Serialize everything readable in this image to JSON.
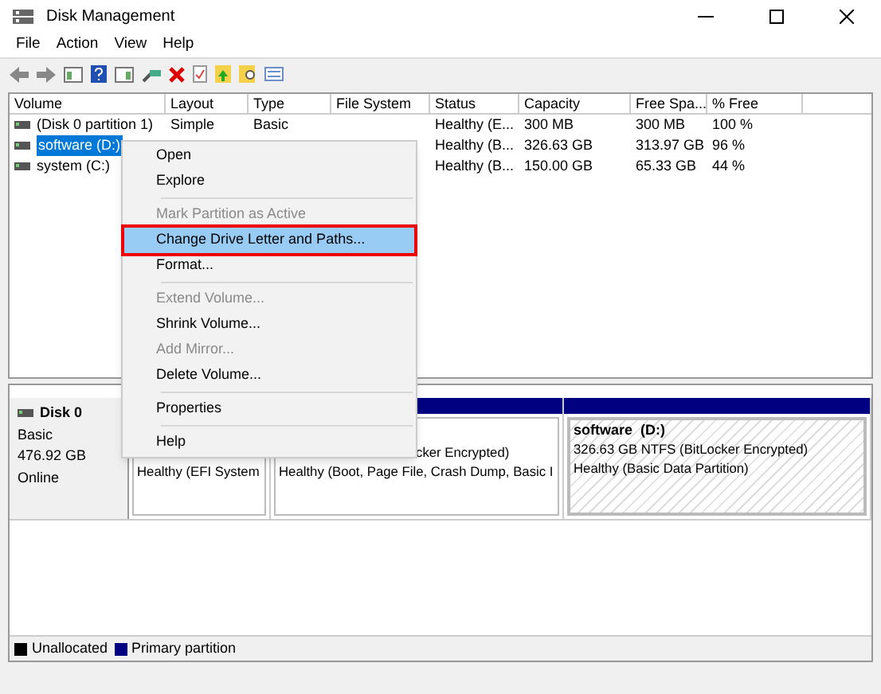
{
  "window": {
    "title": "Disk Management"
  },
  "menu_bar": [
    "File",
    "Action",
    "View",
    "Help"
  ],
  "table": {
    "columns": [
      "Volume",
      "Layout",
      "Type",
      "File System",
      "Status",
      "Capacity",
      "Free Spa...",
      "% Free"
    ],
    "rows": [
      {
        "selected": false,
        "cells": [
          "(Disk 0 partition 1)",
          "Simple",
          "Basic",
          "",
          "Healthy (E...",
          "300 MB",
          "300 MB",
          "100 %"
        ]
      },
      {
        "selected": true,
        "cells": [
          "software (D:)",
          "",
          "",
          "",
          "Healthy (B...",
          "326.63 GB",
          "313.97 GB",
          "96 %"
        ]
      },
      {
        "selected": false,
        "cells": [
          "system (C:)",
          "",
          "",
          "",
          "Healthy (B...",
          "150.00 GB",
          "65.33 GB",
          "44 %"
        ]
      }
    ]
  },
  "context_menu": [
    {
      "kind": "item",
      "label": "Open",
      "disabled": false,
      "selected": false
    },
    {
      "kind": "item",
      "label": "Explore",
      "disabled": false,
      "selected": false
    },
    {
      "kind": "separator"
    },
    {
      "kind": "item",
      "label": "Mark Partition as Active",
      "disabled": true,
      "selected": false
    },
    {
      "kind": "item",
      "label": "Change Drive Letter and Paths...",
      "disabled": false,
      "selected": true
    },
    {
      "kind": "item",
      "label": "Format...",
      "disabled": false,
      "selected": false
    },
    {
      "kind": "separator"
    },
    {
      "kind": "item",
      "label": "Extend Volume...",
      "disabled": true,
      "selected": false
    },
    {
      "kind": "item",
      "label": "Shrink Volume...",
      "disabled": false,
      "selected": false
    },
    {
      "kind": "item",
      "label": "Add Mirror...",
      "disabled": true,
      "selected": false
    },
    {
      "kind": "item",
      "label": "Delete Volume...",
      "disabled": false,
      "selected": false
    },
    {
      "kind": "separator"
    },
    {
      "kind": "item",
      "label": "Properties",
      "disabled": false,
      "selected": false
    },
    {
      "kind": "separator"
    },
    {
      "kind": "item",
      "label": "Help",
      "disabled": false,
      "selected": false
    }
  ],
  "disk": {
    "name": "Disk 0",
    "type": "Basic",
    "size": "476.92 GB",
    "state": "Online"
  },
  "partitions": [
    {
      "lines": [
        "Healthy (EFI System"
      ]
    },
    {
      "lines": [
        "cker Encrypted)",
        "Healthy (Boot, Page File, Crash Dump, Basic I"
      ]
    },
    {
      "title": "software  (D:)",
      "lines": [
        "326.63 GB NTFS (BitLocker Encrypted)",
        "Healthy (Basic Data Partition)"
      ]
    }
  ],
  "legend": [
    {
      "label": "Unallocated",
      "color": "#000000"
    },
    {
      "label": "Primary partition",
      "color": "#000080"
    }
  ]
}
